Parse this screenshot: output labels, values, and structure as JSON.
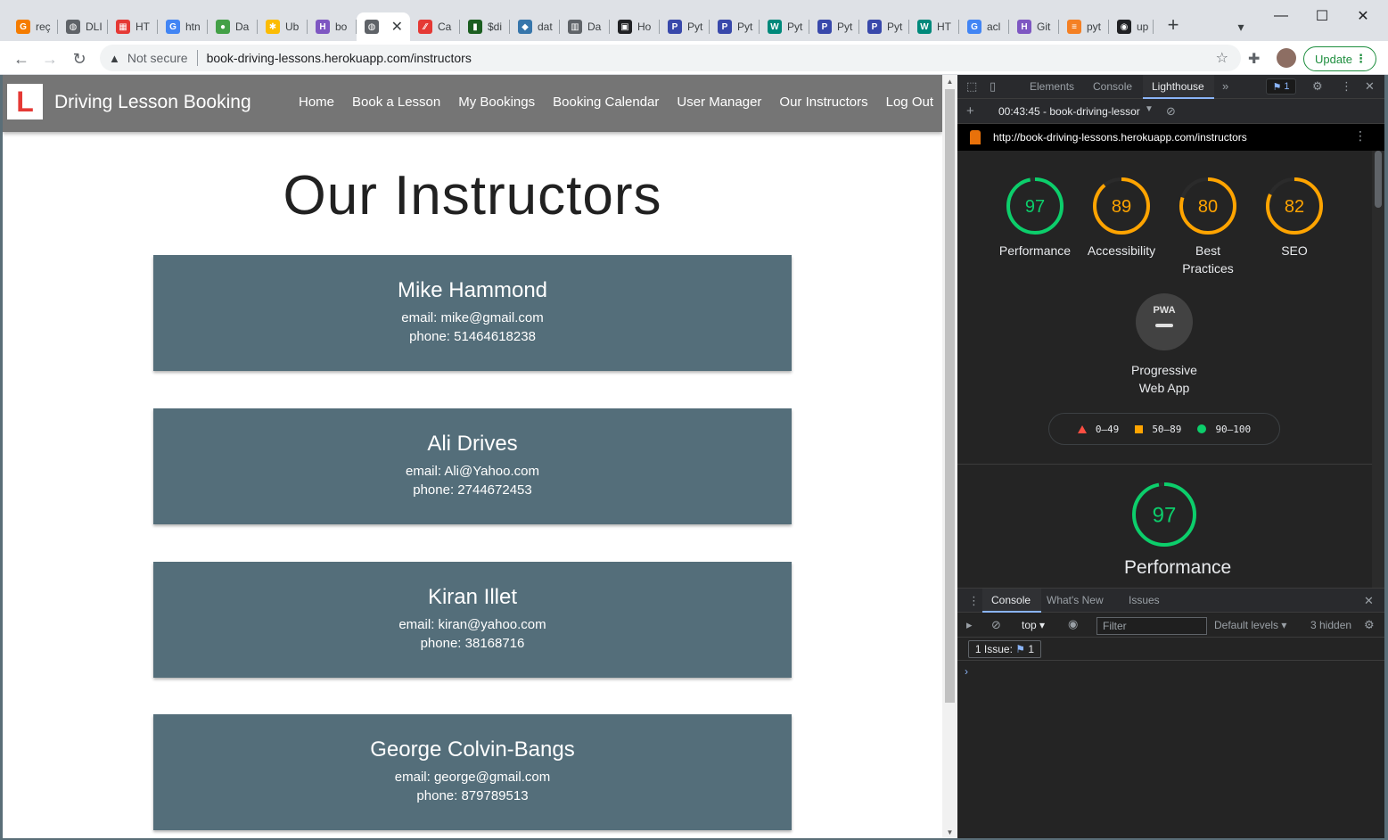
{
  "browser": {
    "tabs": [
      {
        "label": "reç",
        "color": "#f57c00",
        "glyph": "G"
      },
      {
        "label": "DLI",
        "color": "#5f6368",
        "glyph": "◍"
      },
      {
        "label": "HT",
        "color": "#e53935",
        "glyph": "▦"
      },
      {
        "label": "htn",
        "color": "#4285f4",
        "glyph": "G"
      },
      {
        "label": "Da",
        "color": "#43a047",
        "glyph": "●"
      },
      {
        "label": "Ub",
        "color": "#fbbc04",
        "glyph": "✱"
      },
      {
        "label": "bo",
        "color": "#7e57c2",
        "glyph": "H"
      },
      {
        "label": "",
        "color": "#5f6368",
        "glyph": "◍"
      },
      {
        "label": "Ca",
        "color": "#e53935",
        "glyph": "∕∕"
      },
      {
        "label": "$di",
        "color": "#1b5e20",
        "glyph": "▮"
      },
      {
        "label": "dat",
        "color": "#3776ab",
        "glyph": "◆"
      },
      {
        "label": "Da",
        "color": "#5f6368",
        "glyph": "▥"
      },
      {
        "label": "Ho",
        "color": "#202124",
        "glyph": "▣"
      },
      {
        "label": "Pyt",
        "color": "#3949ab",
        "glyph": "P"
      },
      {
        "label": "Pyt",
        "color": "#3949ab",
        "glyph": "P"
      },
      {
        "label": "Pyt",
        "color": "#00897b",
        "glyph": "W"
      },
      {
        "label": "Pyt",
        "color": "#3949ab",
        "glyph": "P"
      },
      {
        "label": "Pyt",
        "color": "#3949ab",
        "glyph": "P"
      },
      {
        "label": "HT",
        "color": "#00897b",
        "glyph": "W"
      },
      {
        "label": "acl",
        "color": "#4285f4",
        "glyph": "G"
      },
      {
        "label": "Git",
        "color": "#7e57c2",
        "glyph": "H"
      },
      {
        "label": "pyt",
        "color": "#f48024",
        "glyph": "≡"
      },
      {
        "label": "up",
        "color": "#202124",
        "glyph": "◉"
      }
    ],
    "active_tab_index": 7,
    "not_secure": "Not secure",
    "url": "book-driving-lessons.herokuapp.com/instructors",
    "update_label": "Update",
    "icons": {
      "back": "arrow-left-icon",
      "forward": "arrow-right-icon",
      "reload": "reload-icon",
      "star": "star-icon",
      "extensions": "puzzle-icon"
    }
  },
  "site": {
    "logo_letter": "L",
    "brand": "Driving Lesson Booking",
    "menu": [
      "Home",
      "Book a Lesson",
      "My Bookings",
      "Booking Calendar",
      "User Manager",
      "Our Instructors",
      "Log Out"
    ],
    "page_title": "Our Instructors",
    "instructors": [
      {
        "name": "Mike Hammond",
        "email": "email: mike@gmail.com",
        "phone": "phone: 51464618238"
      },
      {
        "name": "Ali Drives",
        "email": "email: Ali@Yahoo.com",
        "phone": "phone: 2744672453"
      },
      {
        "name": "Kiran Illet",
        "email": "email: kiran@yahoo.com",
        "phone": "phone: 38168716"
      },
      {
        "name": "George Colvin-Bangs",
        "email": "email: george@gmail.com",
        "phone": "phone: 879789513"
      }
    ]
  },
  "devtools": {
    "tabs": [
      "Elements",
      "Console",
      "Lighthouse"
    ],
    "active_tab": "Lighthouse",
    "issues_badge": "1",
    "report_select": "00:43:45 - book-driving-lessor",
    "report_url": "http://book-driving-lessons.herokuapp.com/instructors",
    "scores": [
      {
        "label": "Performance",
        "value": "97",
        "score": 0.97,
        "color": "#0cce6b"
      },
      {
        "label": "Accessibility",
        "value": "89",
        "score": 0.89,
        "color": "#ffa400"
      },
      {
        "label": "Best Practices",
        "value": "80",
        "score": 0.8,
        "color": "#ffa400"
      },
      {
        "label": "SEO",
        "value": "82",
        "score": 0.82,
        "color": "#ffa400"
      }
    ],
    "pwa": {
      "badge": "PWA",
      "label": "Progressive Web App"
    },
    "legend": [
      {
        "range": "0–49",
        "color": "#ff4e42",
        "shape": "triangle"
      },
      {
        "range": "50–89",
        "color": "#ffa400",
        "shape": "square"
      },
      {
        "range": "90–100",
        "color": "#0cce6b",
        "shape": "circle"
      }
    ],
    "section": {
      "label": "Performance",
      "value": "97",
      "score": 0.97,
      "color": "#0cce6b"
    },
    "drawer": {
      "tabs": [
        "Console",
        "What's New",
        "Issues"
      ],
      "context": "top",
      "filter_placeholder": "Filter",
      "levels": "Default levels",
      "hidden": "3 hidden",
      "issues_text": "1 Issue:",
      "issues_count": "1",
      "prompt": "›"
    }
  }
}
